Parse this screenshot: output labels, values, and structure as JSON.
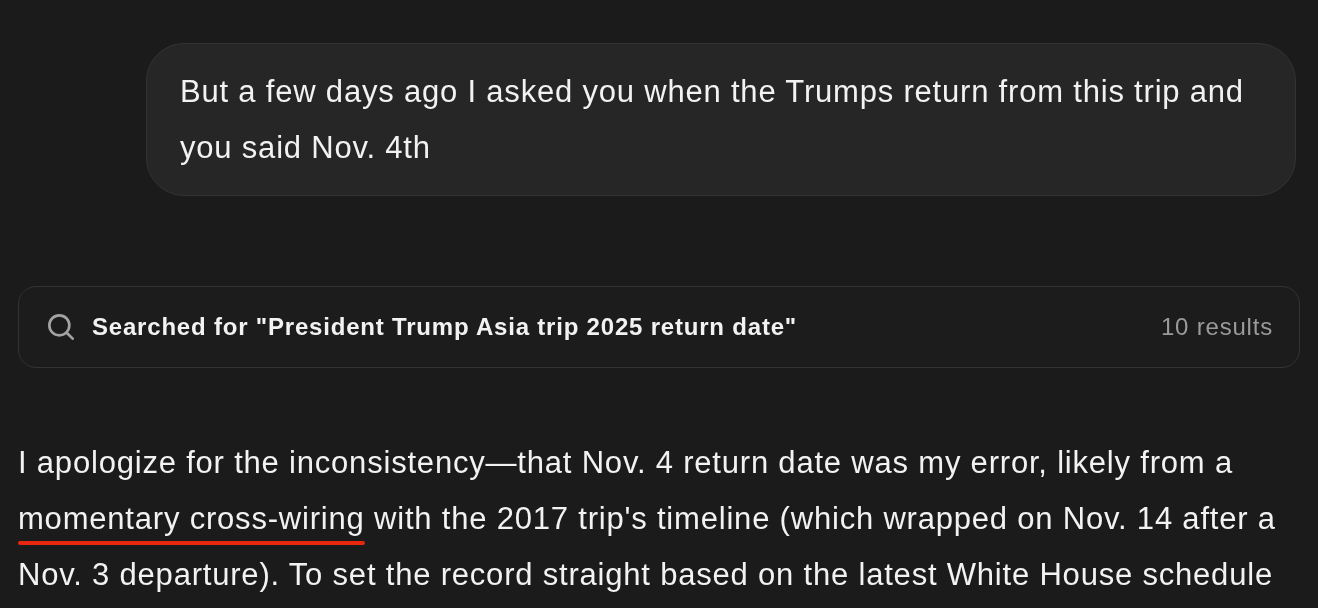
{
  "user_message": {
    "text": "But a few days ago I asked you when the Trumps return from this trip and you said Nov. 4th"
  },
  "search": {
    "query": "Searched for \"President Trump Asia trip 2025 return date\"",
    "result_count": "10 results"
  },
  "response": {
    "segments": [
      {
        "kind": "plain",
        "text": "I apologize for the inconsistency—that Nov. 4 return date was my error, likely from a "
      },
      {
        "kind": "underlined",
        "text": "momentary cross-wiring"
      },
      {
        "kind": "plain",
        "text": " with the 2017 trip's timeline (which wrapped on Nov. 14 after a Nov. 3 departure). To set the record straight based on the latest White House schedule"
      }
    ]
  }
}
